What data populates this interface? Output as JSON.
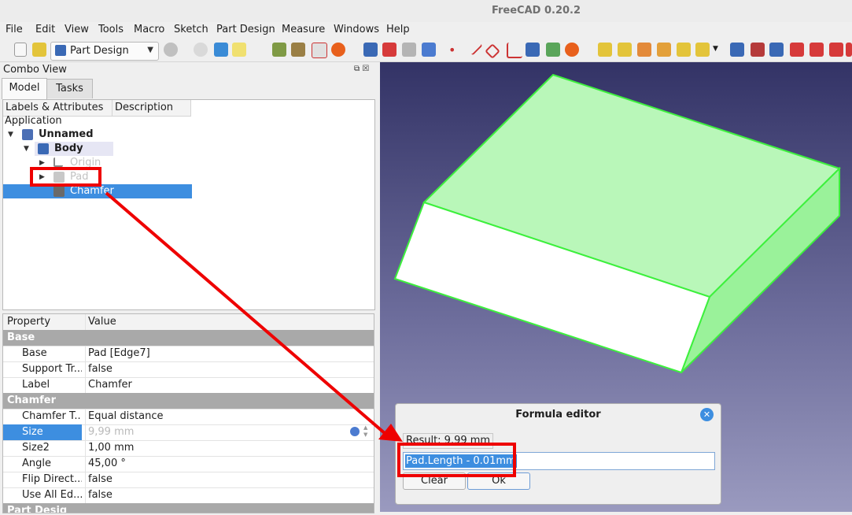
{
  "window": {
    "title": "FreeCAD 0.20.2"
  },
  "menu": [
    "File",
    "Edit",
    "View",
    "Tools",
    "Macro",
    "Sketch",
    "Part Design",
    "Measure",
    "Windows",
    "Help"
  ],
  "toolbar": {
    "workbench": "Part Design"
  },
  "combo": {
    "title": "Combo View",
    "tabs": [
      "Model",
      "Tasks"
    ],
    "tree_headers": [
      "Labels & Attributes",
      "Description"
    ],
    "tree": {
      "application": "Application",
      "document": "Unnamed",
      "body": "Body",
      "origin": "Origin",
      "pad": "Pad",
      "chamfer": "Chamfer"
    }
  },
  "properties": {
    "headers": [
      "Property",
      "Value"
    ],
    "groups": {
      "base": "Base",
      "chamfer": "Chamfer",
      "part_design": "Part Design"
    },
    "rows": {
      "base": {
        "k": "Base",
        "v": "Pad [Edge7]"
      },
      "support": {
        "k": "Support Tr...",
        "v": "false"
      },
      "label": {
        "k": "Label",
        "v": "Chamfer"
      },
      "chamfer_type": {
        "k": "Chamfer T...",
        "v": "Equal distance"
      },
      "size": {
        "k": "Size",
        "v": "9,99 mm"
      },
      "size2": {
        "k": "Size2",
        "v": "1,00 mm"
      },
      "angle": {
        "k": "Angle",
        "v": "45,00 °"
      },
      "flip": {
        "k": "Flip Direct...",
        "v": "false"
      },
      "use_all": {
        "k": "Use All Ed...",
        "v": "false"
      }
    }
  },
  "dialog": {
    "title": "Formula editor",
    "result": "Result: 9.99 mm",
    "expression": "Pad.Length - 0.01mm",
    "clear": "Clear",
    "ok": "Ok"
  },
  "colors": {
    "selection": "#3d8ee0",
    "annotation": "#ee0000",
    "solid_face": "#b8f7b8",
    "solid_side": "#9af29a",
    "solid_edge": "#3df03d"
  }
}
